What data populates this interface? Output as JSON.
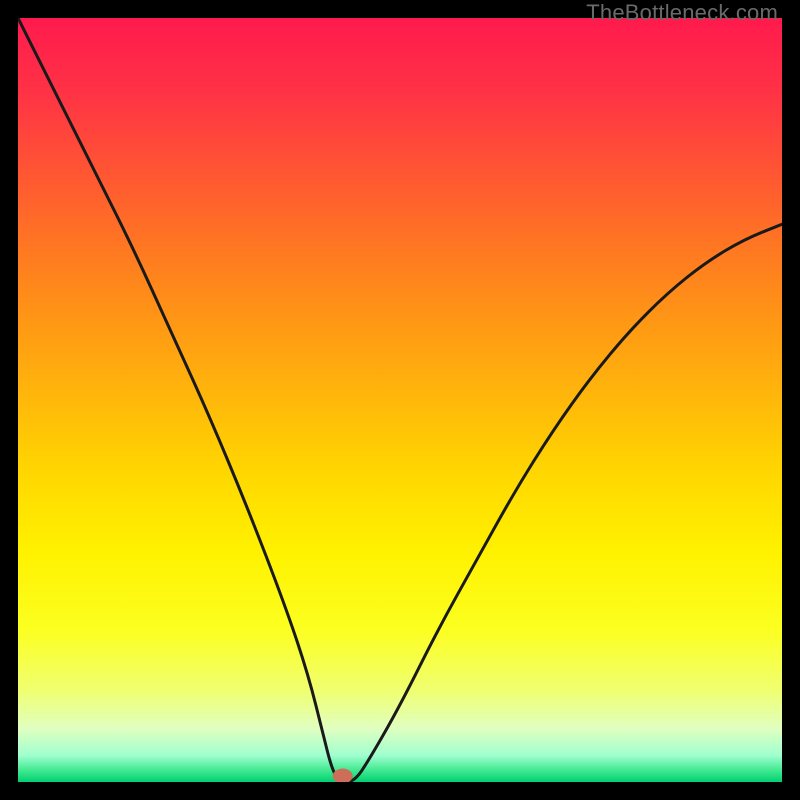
{
  "watermark": "TheBottleneck.com",
  "gradient": {
    "stops": [
      {
        "offset": 0.0,
        "color": "#ff1a4d"
      },
      {
        "offset": 0.1,
        "color": "#ff3345"
      },
      {
        "offset": 0.2,
        "color": "#ff5533"
      },
      {
        "offset": 0.3,
        "color": "#ff7722"
      },
      {
        "offset": 0.4,
        "color": "#ff9814"
      },
      {
        "offset": 0.5,
        "color": "#ffb80a"
      },
      {
        "offset": 0.6,
        "color": "#ffd800"
      },
      {
        "offset": 0.7,
        "color": "#fff200"
      },
      {
        "offset": 0.8,
        "color": "#fcff20"
      },
      {
        "offset": 0.88,
        "color": "#f0ff70"
      },
      {
        "offset": 0.93,
        "color": "#e0ffc0"
      },
      {
        "offset": 0.965,
        "color": "#a0ffd0"
      },
      {
        "offset": 0.985,
        "color": "#40e890"
      },
      {
        "offset": 1.0,
        "color": "#00d070"
      }
    ]
  },
  "marker": {
    "x_pct": 42.5,
    "radius": 10,
    "color": "#cc6e5a"
  },
  "chart_data": {
    "type": "line",
    "title": "",
    "xlabel": "",
    "ylabel": "",
    "xlim": [
      0,
      100
    ],
    "ylim": [
      0,
      100
    ],
    "series": [
      {
        "name": "bottleneck-curve",
        "x": [
          0,
          5,
          10,
          15,
          20,
          25,
          30,
          35,
          38,
          40,
          41,
          42,
          44,
          46,
          50,
          55,
          60,
          65,
          70,
          75,
          80,
          85,
          90,
          95,
          100
        ],
        "y": [
          100,
          90,
          80,
          70,
          59,
          48,
          36,
          23,
          14,
          6,
          2,
          0,
          0,
          3,
          10,
          20,
          29,
          38,
          46,
          53,
          59,
          64,
          68,
          71,
          73
        ],
        "notch": {
          "x_start": 40.5,
          "x_end": 44.5,
          "y": 0
        }
      }
    ],
    "marker_point": {
      "x": 42.5,
      "y": 0
    }
  }
}
